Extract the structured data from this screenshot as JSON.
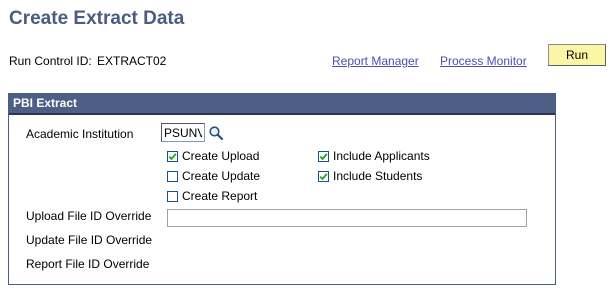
{
  "page": {
    "title": "Create Extract Data"
  },
  "run_control": {
    "label": "Run Control ID:",
    "value": "EXTRACT02",
    "report_manager_label": "Report Manager",
    "process_monitor_label": "Process Monitor",
    "run_label": "Run"
  },
  "panel": {
    "title": "PBI Extract",
    "academic_institution": {
      "label": "Academic Institution",
      "value": "PSUNV"
    },
    "options": {
      "create_upload": {
        "label": "Create Upload",
        "checked": true
      },
      "create_update": {
        "label": "Create Update",
        "checked": false
      },
      "create_report": {
        "label": "Create Report",
        "checked": false
      },
      "include_applicants": {
        "label": "Include Applicants",
        "checked": true
      },
      "include_students": {
        "label": "Include Students",
        "checked": true
      }
    },
    "upload_file_id_override": {
      "label": "Upload File ID Override",
      "value": ""
    },
    "update_file_id_override": {
      "label": "Update File ID Override"
    },
    "report_file_id_override": {
      "label": "Report File ID Override"
    }
  },
  "colors": {
    "title": "#4a5c82",
    "panel_header_bg": "#4d5f85",
    "link": "#4d4db3",
    "run_button_bg": "#fbf5a6",
    "checkmark": "#21a121"
  }
}
